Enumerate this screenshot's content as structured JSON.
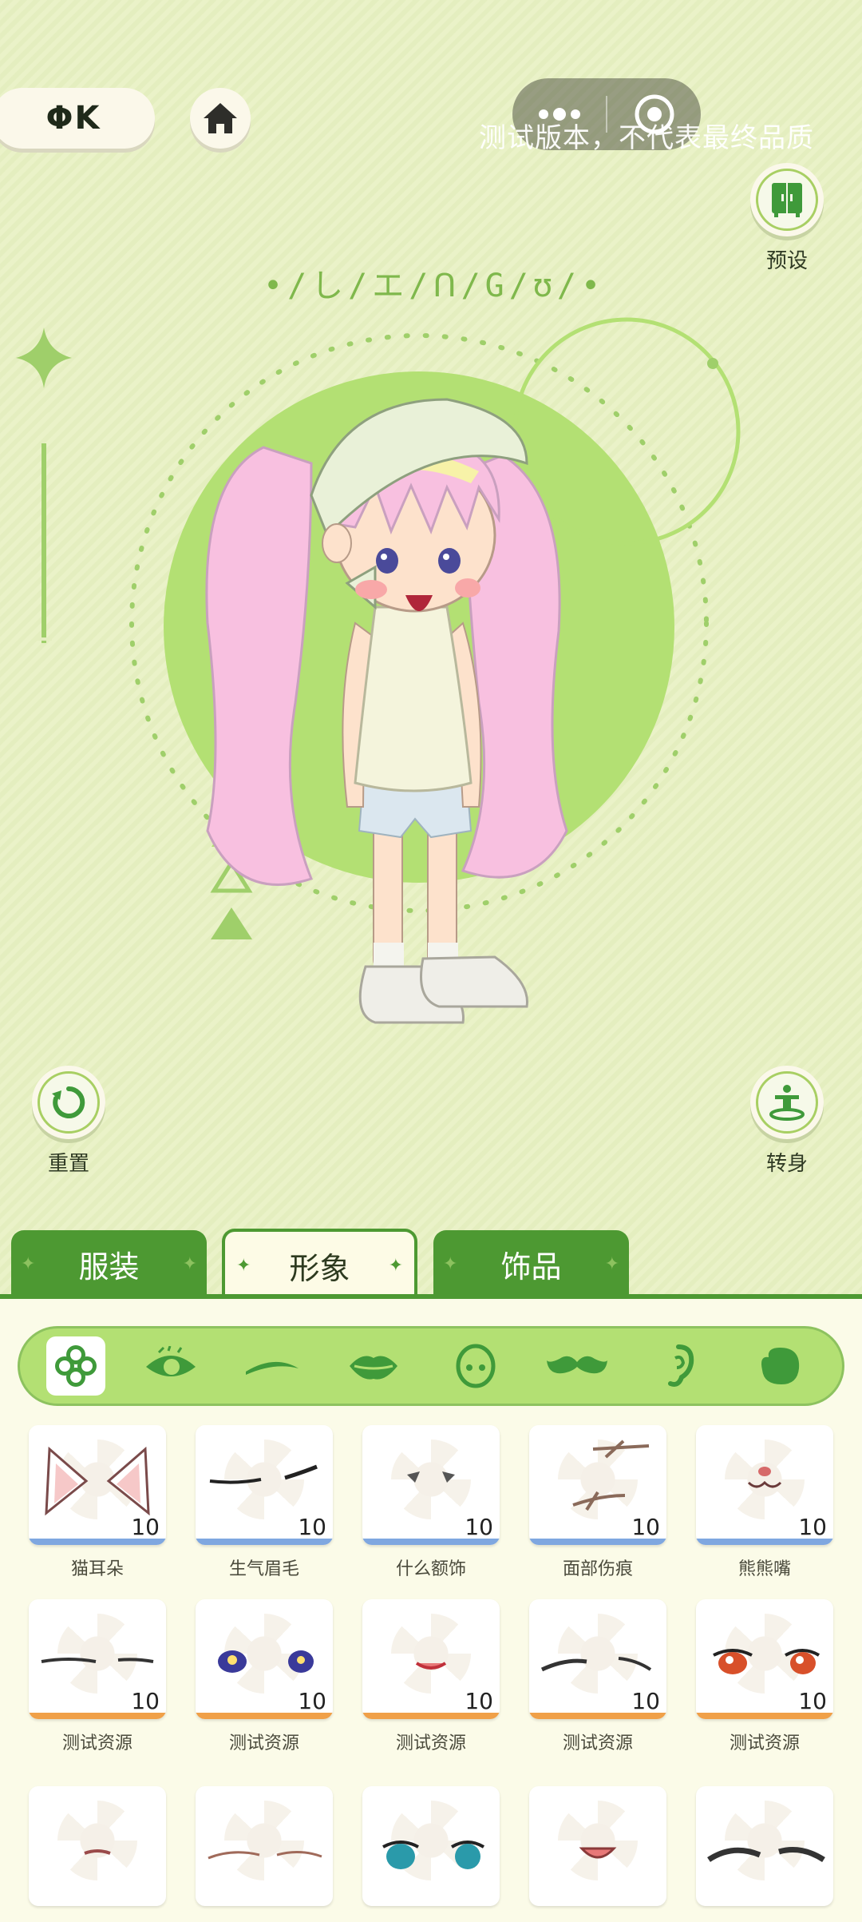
{
  "header": {
    "logo_text": "ΦK",
    "watermark": "测试版本，不代表最终品质"
  },
  "rune_text": "•/し/エ/ᑎ/G/ʊ/•",
  "buttons": {
    "preset": "预设",
    "reset": "重置",
    "turn": "转身"
  },
  "tabs": [
    {
      "label": "服装",
      "active": false
    },
    {
      "label": "形象",
      "active": true
    },
    {
      "label": "饰品",
      "active": false
    }
  ],
  "categories": [
    {
      "icon": "clover-icon",
      "selected": true
    },
    {
      "icon": "eye-icon",
      "selected": false
    },
    {
      "icon": "eyebrow-icon",
      "selected": false
    },
    {
      "icon": "lips-icon",
      "selected": false
    },
    {
      "icon": "face-icon",
      "selected": false
    },
    {
      "icon": "mustache-icon",
      "selected": false
    },
    {
      "icon": "ear-icon",
      "selected": false
    },
    {
      "icon": "hair-icon",
      "selected": false
    }
  ],
  "items_row1": [
    {
      "name": "猫耳朵",
      "count": "10",
      "stripe": "#7fa7e0",
      "art": "cat-ears"
    },
    {
      "name": "生气眉毛",
      "count": "10",
      "stripe": "#7fa7e0",
      "art": "angry-brows"
    },
    {
      "name": "什么额饰",
      "count": "10",
      "stripe": "#7fa7e0",
      "art": "forehead"
    },
    {
      "name": "面部伤痕",
      "count": "10",
      "stripe": "#7fa7e0",
      "art": "scars"
    },
    {
      "name": "熊熊嘴",
      "count": "10",
      "stripe": "#7fa7e0",
      "art": "bear-mouth"
    }
  ],
  "items_row2": [
    {
      "name": "测试资源",
      "count": "10",
      "stripe": "#f0a048",
      "art": "brows-a"
    },
    {
      "name": "测试资源",
      "count": "10",
      "stripe": "#f0a048",
      "art": "eyes-a"
    },
    {
      "name": "测试资源",
      "count": "10",
      "stripe": "#f0a048",
      "art": "smile"
    },
    {
      "name": "测试资源",
      "count": "10",
      "stripe": "#f0a048",
      "art": "brows-b"
    },
    {
      "name": "测试资源",
      "count": "10",
      "stripe": "#f0a048",
      "art": "eyes-b"
    }
  ],
  "items_row3": [
    {
      "art": "mouth-small"
    },
    {
      "art": "brows-thin"
    },
    {
      "art": "eyes-c"
    },
    {
      "art": "open-mouth"
    },
    {
      "art": "brows-thick"
    }
  ],
  "colors": {
    "accent_green": "#4d9932",
    "light_green": "#b3e073",
    "stripe_blue": "#7fa7e0",
    "stripe_orange": "#f0a048"
  }
}
